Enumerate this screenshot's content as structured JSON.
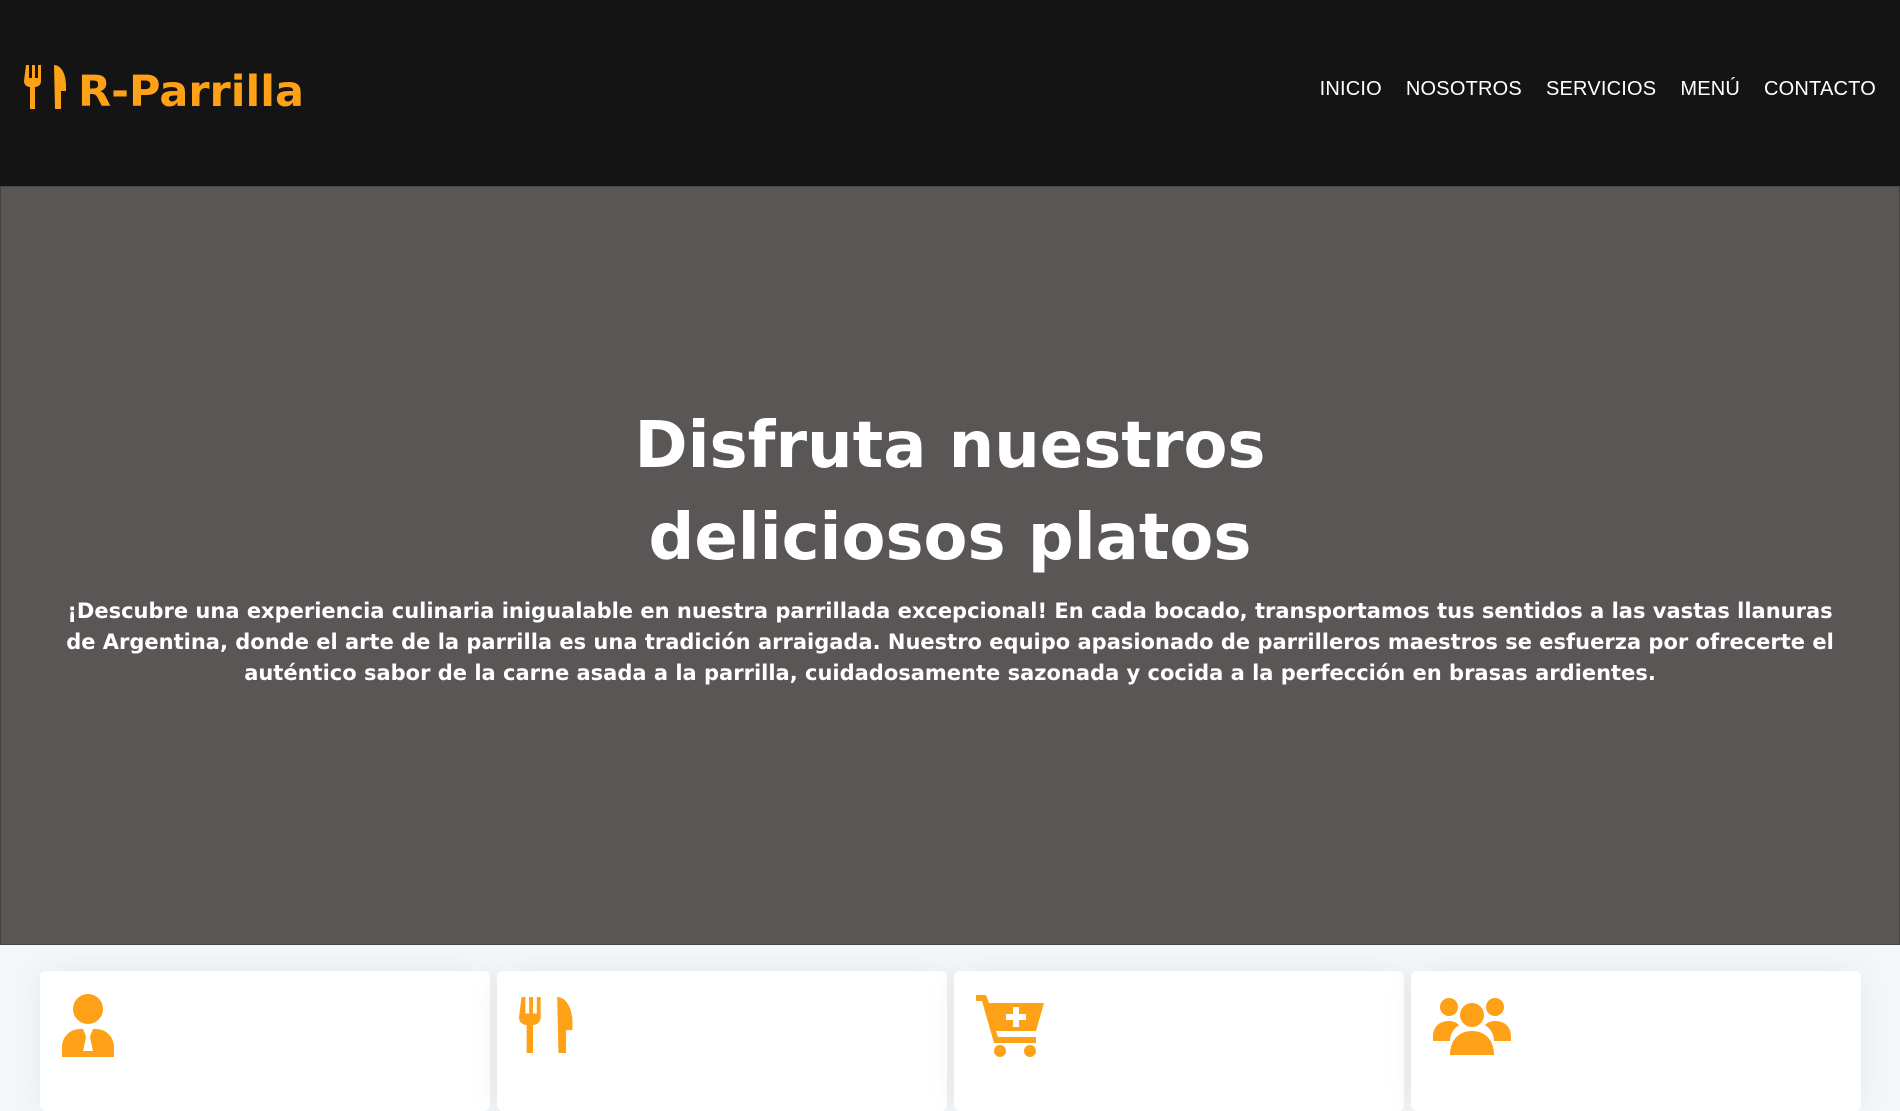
{
  "brand": {
    "name": "R-Parrilla",
    "icon": "utensils-icon",
    "color": "#fea116"
  },
  "nav": {
    "items": [
      {
        "label": "INICIO"
      },
      {
        "label": "NOSOTROS"
      },
      {
        "label": "SERVICIOS"
      },
      {
        "label": "MENÚ"
      },
      {
        "label": "CONTACTO"
      }
    ]
  },
  "hero": {
    "title": "Disfruta nuestros deliciosos platos",
    "text": "¡Descubre una experiencia culinaria inigualable en nuestra parrillada excepcional! En cada bocado, transportamos tus sentidos a las vastas llanuras de Argentina, donde el arte de la parrilla es una tradición arraigada. Nuestro equipo apasionado de parrilleros maestros se esfuerza por ofrecerte el auténtico sabor de la carne asada a la parrilla, cuidadosamente sazonada y cocida a la perfección en brasas ardientes."
  },
  "services": [
    {
      "icon": "chef-user-icon",
      "title": ""
    },
    {
      "icon": "utensils-icon",
      "title": ""
    },
    {
      "icon": "cart-plus-icon",
      "title": ""
    },
    {
      "icon": "users-icon",
      "title": ""
    }
  ],
  "colors": {
    "accent": "#fea116",
    "navbar": "#141414",
    "page_bg": "#f3f7fa"
  }
}
